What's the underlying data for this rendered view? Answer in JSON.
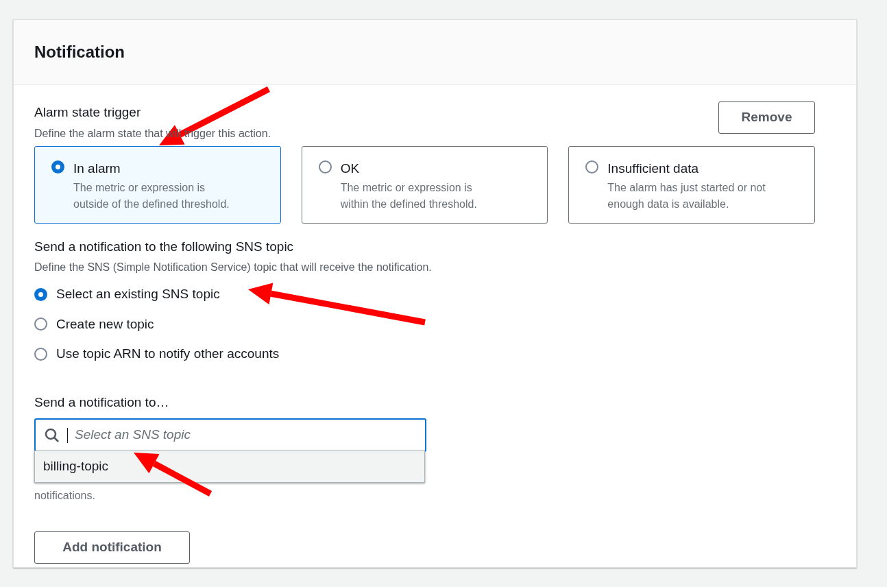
{
  "panel": {
    "title": "Notification",
    "remove_button": "Remove"
  },
  "alarm_state": {
    "label": "Alarm state trigger",
    "description": "Define the alarm state that will trigger this action.",
    "options": [
      {
        "title": "In alarm",
        "description": "The metric or expression is outside of the defined threshold.",
        "selected": true
      },
      {
        "title": "OK",
        "description": "The metric or expression is within the defined threshold.",
        "selected": false
      },
      {
        "title": "Insufficient data",
        "description": "The alarm has just started or not enough data is available.",
        "selected": false
      }
    ]
  },
  "sns_topic": {
    "label": "Send a notification to the following SNS topic",
    "description": "Define the SNS (Simple Notification Service) topic that will receive the notification.",
    "options": [
      {
        "label": "Select an existing SNS topic",
        "selected": true
      },
      {
        "label": "Create new topic",
        "selected": false
      },
      {
        "label": "Use topic ARN to notify other accounts",
        "selected": false
      }
    ]
  },
  "send_to": {
    "label": "Send a notification to…",
    "placeholder": "Select an SNS topic",
    "dropdown_items": [
      "billing-topic"
    ],
    "hint": "notifications."
  },
  "add_button": "Add notification",
  "annotations": [
    {
      "kind": "arrow"
    },
    {
      "kind": "arrow"
    },
    {
      "kind": "arrow"
    }
  ]
}
